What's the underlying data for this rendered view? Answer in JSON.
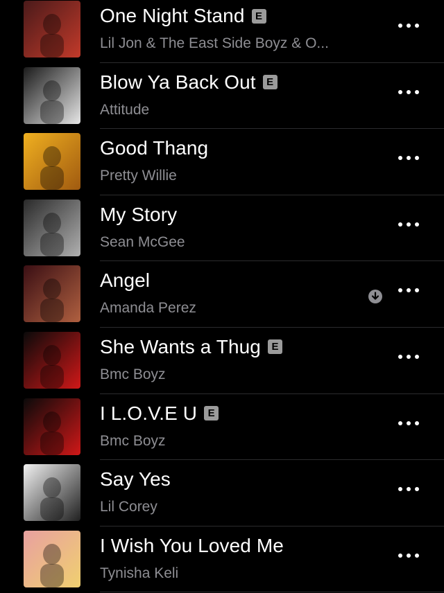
{
  "songs": [
    {
      "title": "One Night Stand",
      "artist": "Lil Jon & The East Side Boyz & O...",
      "explicit": true,
      "downloaded": false,
      "art_colors": [
        "#4a1a1a",
        "#c23a2a"
      ]
    },
    {
      "title": "Blow Ya Back Out",
      "artist": "Attitude",
      "explicit": true,
      "downloaded": false,
      "art_colors": [
        "#1b1b1b",
        "#e6e6e6"
      ]
    },
    {
      "title": "Good Thang",
      "artist": "Pretty Willie",
      "explicit": false,
      "downloaded": false,
      "art_colors": [
        "#f0b020",
        "#a05a10"
      ]
    },
    {
      "title": "My Story",
      "artist": "Sean McGee",
      "explicit": false,
      "downloaded": false,
      "art_colors": [
        "#2a2a2a",
        "#b0b0b0"
      ]
    },
    {
      "title": "Angel",
      "artist": "Amanda Perez",
      "explicit": false,
      "downloaded": true,
      "art_colors": [
        "#3a0f14",
        "#b06040"
      ]
    },
    {
      "title": "She Wants a Thug",
      "artist": "Bmc Boyz",
      "explicit": true,
      "downloaded": false,
      "art_colors": [
        "#0a0a0a",
        "#d01818"
      ]
    },
    {
      "title": "I L.O.V.E U",
      "artist": "Bmc Boyz",
      "explicit": true,
      "downloaded": false,
      "art_colors": [
        "#0a0a0a",
        "#d01818"
      ]
    },
    {
      "title": "Say Yes",
      "artist": "Lil Corey",
      "explicit": false,
      "downloaded": false,
      "art_colors": [
        "#f2f2f2",
        "#202020"
      ]
    },
    {
      "title": "I Wish You Loved Me",
      "artist": "Tynisha Keli",
      "explicit": false,
      "downloaded": false,
      "art_colors": [
        "#e8a0a0",
        "#f0d070"
      ]
    }
  ],
  "explicit_badge": "E",
  "icons": {
    "more": "ellipsis-icon",
    "download": "downloaded-icon"
  }
}
